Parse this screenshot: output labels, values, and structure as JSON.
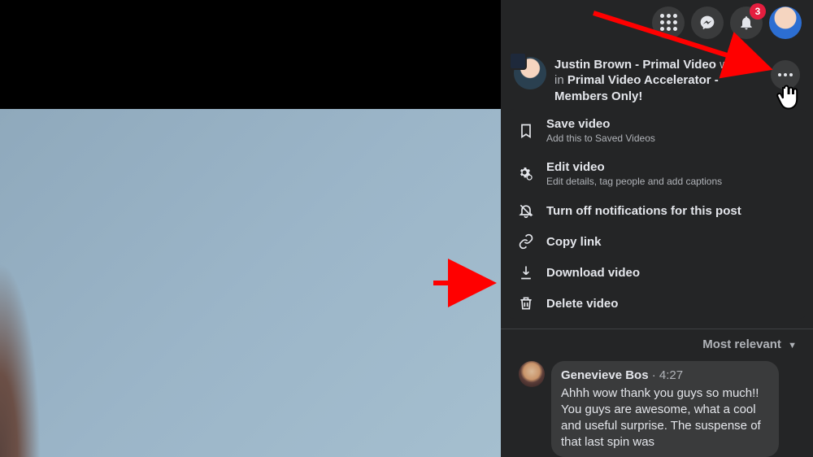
{
  "topbar": {
    "notificationBadge": "3"
  },
  "post": {
    "author": "Justin Brown - Primal Video",
    "subPrefix": "was live in ",
    "group": "Primal Video Accelerator - Members Only!"
  },
  "menu": {
    "save": {
      "title": "Save video",
      "desc": "Add this to Saved Videos"
    },
    "edit": {
      "title": "Edit video",
      "desc": "Edit details, tag people and add captions"
    },
    "notif": {
      "title": "Turn off notifications for this post"
    },
    "copy": {
      "title": "Copy link"
    },
    "download": {
      "title": "Download video"
    },
    "delete": {
      "title": "Delete video"
    }
  },
  "relevance": {
    "label": "Most relevant"
  },
  "comment": {
    "author": "Genevieve Bos",
    "time": "4:27",
    "sep": " · ",
    "body": "Ahhh wow thank you guys so much!! You guys are awesome, what a cool and useful surprise. The suspense of that last spin was"
  }
}
